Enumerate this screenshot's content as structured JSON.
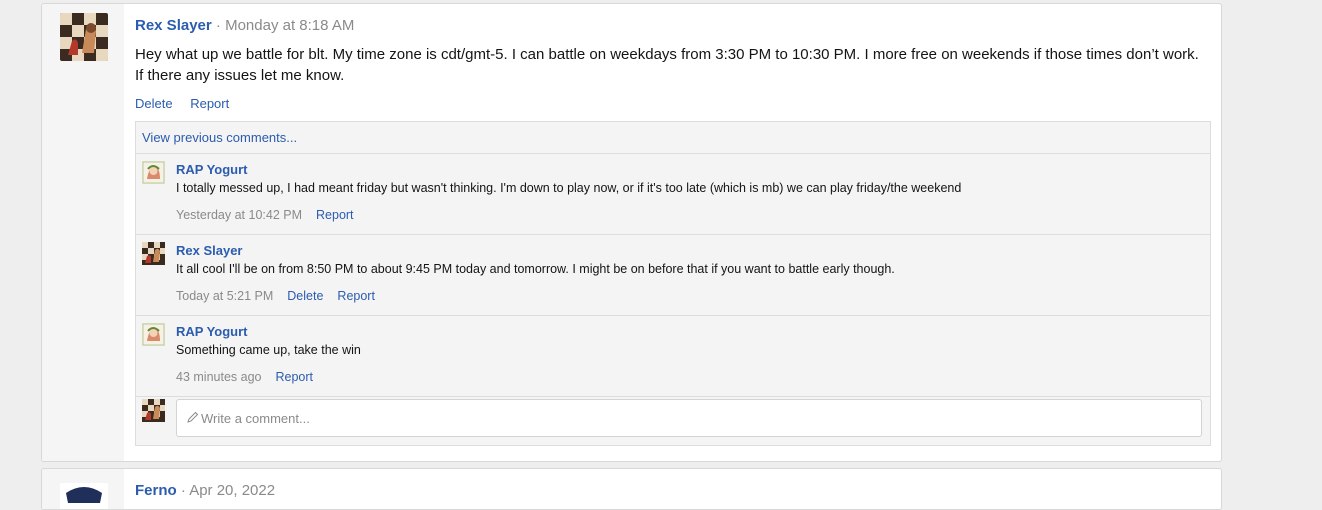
{
  "post": {
    "author": "Rex Slayer",
    "separator": "·",
    "time": "Monday at 8:18 AM",
    "body_line1": "Hey what up we battle for blt. My time zone is cdt/gmt-5. I can battle on weekdays from 3:30 PM to 10:30 PM. I more free on weekends if those times don’t work.",
    "body_line2": "If there any issues let me know.",
    "actions": {
      "delete": "Delete",
      "report": "Report"
    },
    "view_previous": "View previous comments...",
    "comments": [
      {
        "user": "RAP Yogurt",
        "text": "I totally messed up, I had meant friday but wasn't thinking. I'm down to play now, or if it's too late (which is mb) we can play friday/the weekend",
        "time": "Yesterday at 10:42 PM",
        "report": "Report"
      },
      {
        "user": "Rex Slayer",
        "text": "It all cool I'll be on from 8:50 PM to about 9:45 PM today and tomorrow. I might be on before that if you want to battle early though.",
        "time": "Today at 5:21 PM",
        "delete": "Delete",
        "report": "Report"
      },
      {
        "user": "RAP Yogurt",
        "text": "Something came up, take the win",
        "time": "43 minutes ago",
        "report": "Report"
      }
    ],
    "write_placeholder": "Write a comment..."
  },
  "next_post": {
    "author": "Ferno",
    "separator": "·",
    "time": "Apr 20, 2022"
  },
  "colors": {
    "link": "#2b5cb0",
    "muted": "#8a8a8a",
    "panel": "#f4f4f4"
  }
}
